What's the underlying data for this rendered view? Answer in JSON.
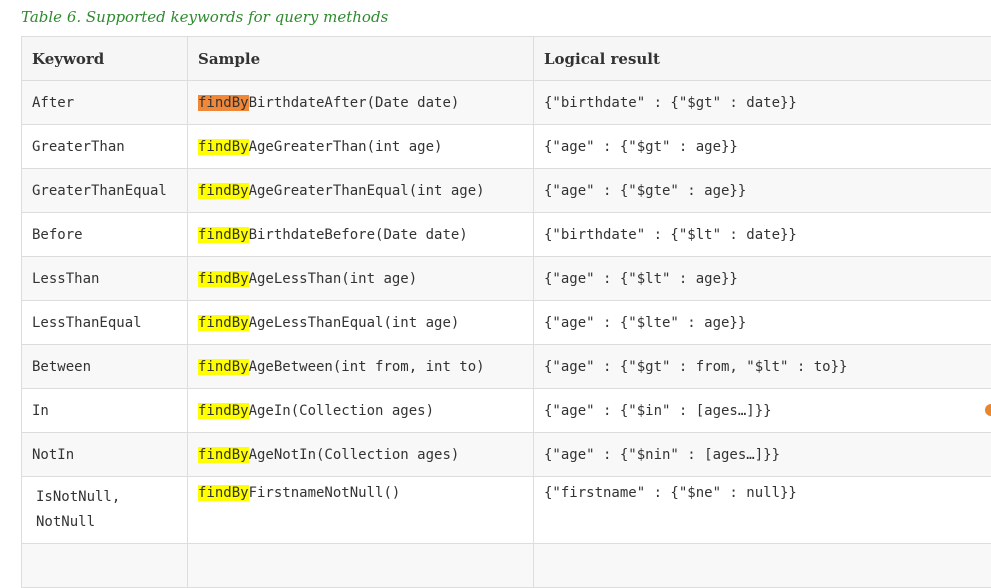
{
  "caption": "Table 6. Supported keywords for query methods",
  "headers": [
    "Keyword",
    "Sample",
    "Logical result"
  ],
  "highlight_term": "findBy",
  "rows": [
    {
      "keyword": "After",
      "sample_rest": "BirthdateAfter(Date date)",
      "result": "{\"birthdate\" : {\"$gt\" : date}}"
    },
    {
      "keyword": "GreaterThan",
      "sample_rest": "AgeGreaterThan(int age)",
      "result": "{\"age\" : {\"$gt\" : age}}"
    },
    {
      "keyword": "GreaterThanEqual",
      "sample_rest": "AgeGreaterThanEqual(int age)",
      "result": "{\"age\" : {\"$gte\" : age}}"
    },
    {
      "keyword": "Before",
      "sample_rest": "BirthdateBefore(Date date)",
      "result": "{\"birthdate\" : {\"$lt\" : date}}"
    },
    {
      "keyword": "LessThan",
      "sample_rest": "AgeLessThan(int age)",
      "result": "{\"age\" : {\"$lt\" : age}}"
    },
    {
      "keyword": "LessThanEqual",
      "sample_rest": "AgeLessThanEqual(int age)",
      "result": "{\"age\" : {\"$lte\" : age}}"
    },
    {
      "keyword": "Between",
      "sample_rest": "AgeBetween(int from, int to)",
      "result": "{\"age\" : {\"$gt\" : from, \"$lt\" : to}}"
    },
    {
      "keyword": "In",
      "sample_rest": "AgeIn(Collection ages)",
      "result": "{\"age\" : {\"$in\" : [ages…]}}"
    },
    {
      "keyword": "NotIn",
      "sample_rest": "AgeNotIn(Collection ages)",
      "result": "{\"age\" : {\"$nin\" : [ages…]}}"
    },
    {
      "keyword": "IsNotNull, NotNull",
      "sample_rest": "FirstnameNotNull()",
      "result": "{\"firstname\" : {\"$ne\" : null}}"
    }
  ],
  "colors": {
    "caption": "#2e8b2e",
    "highlight": "#ffff00",
    "highlight_active": "#f0883a",
    "border": "#dddddd"
  }
}
